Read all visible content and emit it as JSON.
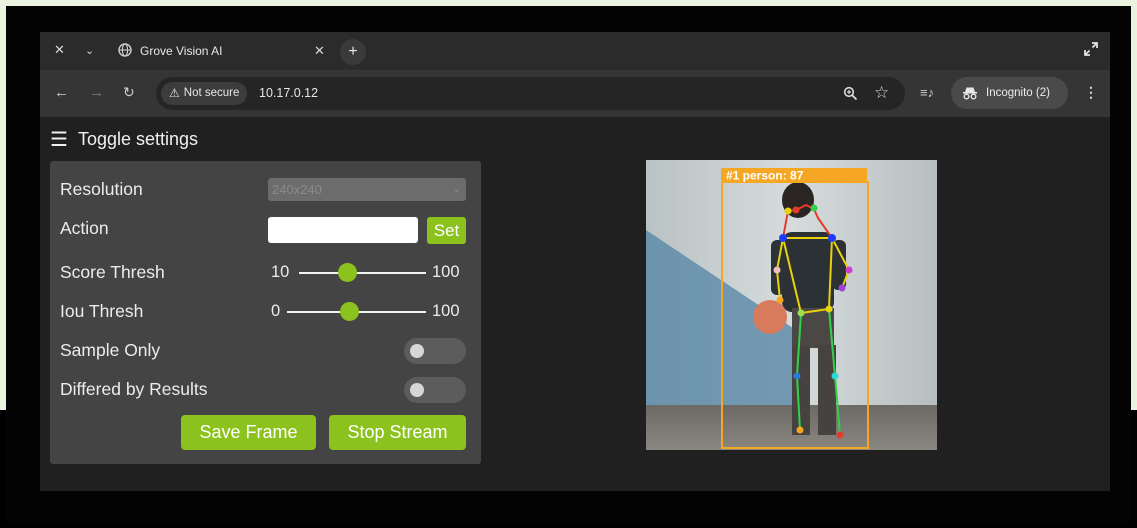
{
  "browser": {
    "tab_title": "Grove Vision AI",
    "security_label": "Not secure",
    "url": "10.17.0.12",
    "incognito_label": "Incognito (2)"
  },
  "page": {
    "toggle_label": "Toggle settings",
    "settings": {
      "resolution_label": "Resolution",
      "resolution_value": "240x240",
      "action_label": "Action",
      "action_value": "",
      "set_label": "Set",
      "score_label": "Score Thresh",
      "score_min": "10",
      "score_max": "100",
      "score_value_fraction": 0.38,
      "iou_label": "Iou Thresh",
      "iou_min": "0",
      "iou_max": "100",
      "iou_value_fraction": 0.45,
      "sample_only_label": "Sample Only",
      "sample_only_on": false,
      "differed_label": "Differed by Results",
      "differed_on": false,
      "save_frame_label": "Save Frame",
      "stop_stream_label": "Stop Stream"
    },
    "detection": {
      "label": "#1 person: 87",
      "box_color": "#f5a623",
      "skeleton_color": "#e8d20a"
    }
  },
  "colors": {
    "accent": "#8cc21e",
    "panel": "#444444",
    "page_bg": "#202020"
  }
}
